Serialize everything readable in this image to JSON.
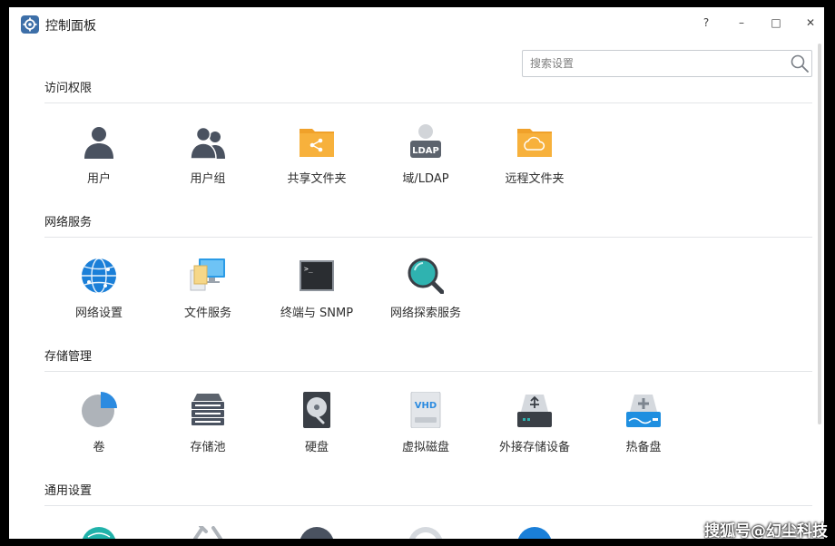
{
  "window": {
    "title": "控制面板",
    "controls": {
      "help": "?",
      "minimize": "–",
      "maximize": "□",
      "close": "✕"
    }
  },
  "search": {
    "placeholder": "搜索设置"
  },
  "sections": [
    {
      "title": "访问权限",
      "items": [
        {
          "label": "用户",
          "icon": "user-icon"
        },
        {
          "label": "用户组",
          "icon": "user-group-icon"
        },
        {
          "label": "共享文件夹",
          "icon": "shared-folder-icon"
        },
        {
          "label": "域/LDAP",
          "icon": "ldap-icon",
          "badge": "LDAP"
        },
        {
          "label": "远程文件夹",
          "icon": "remote-folder-icon"
        }
      ]
    },
    {
      "title": "网络服务",
      "items": [
        {
          "label": "网络设置",
          "icon": "network-globe-icon"
        },
        {
          "label": "文件服务",
          "icon": "file-service-icon"
        },
        {
          "label": "终端与 SNMP",
          "icon": "terminal-icon",
          "badge": ">_"
        },
        {
          "label": "网络探索服务",
          "icon": "network-discovery-icon"
        }
      ]
    },
    {
      "title": "存储管理",
      "items": [
        {
          "label": "卷",
          "icon": "volume-pie-icon"
        },
        {
          "label": "存储池",
          "icon": "storage-pool-icon"
        },
        {
          "label": "硬盘",
          "icon": "hard-disk-icon"
        },
        {
          "label": "虚拟磁盘",
          "icon": "virtual-disk-icon",
          "badge": "VHD"
        },
        {
          "label": "外接存储设备",
          "icon": "external-storage-icon"
        },
        {
          "label": "热备盘",
          "icon": "hot-spare-icon"
        }
      ]
    },
    {
      "title": "通用设置",
      "items": []
    }
  ],
  "watermark": "搜狐号@幻尘科技",
  "colors": {
    "accent_orange": "#f5a623",
    "accent_blue": "#1a7fd8",
    "teal": "#20b2aa",
    "icon_gray": "#4a5260"
  }
}
